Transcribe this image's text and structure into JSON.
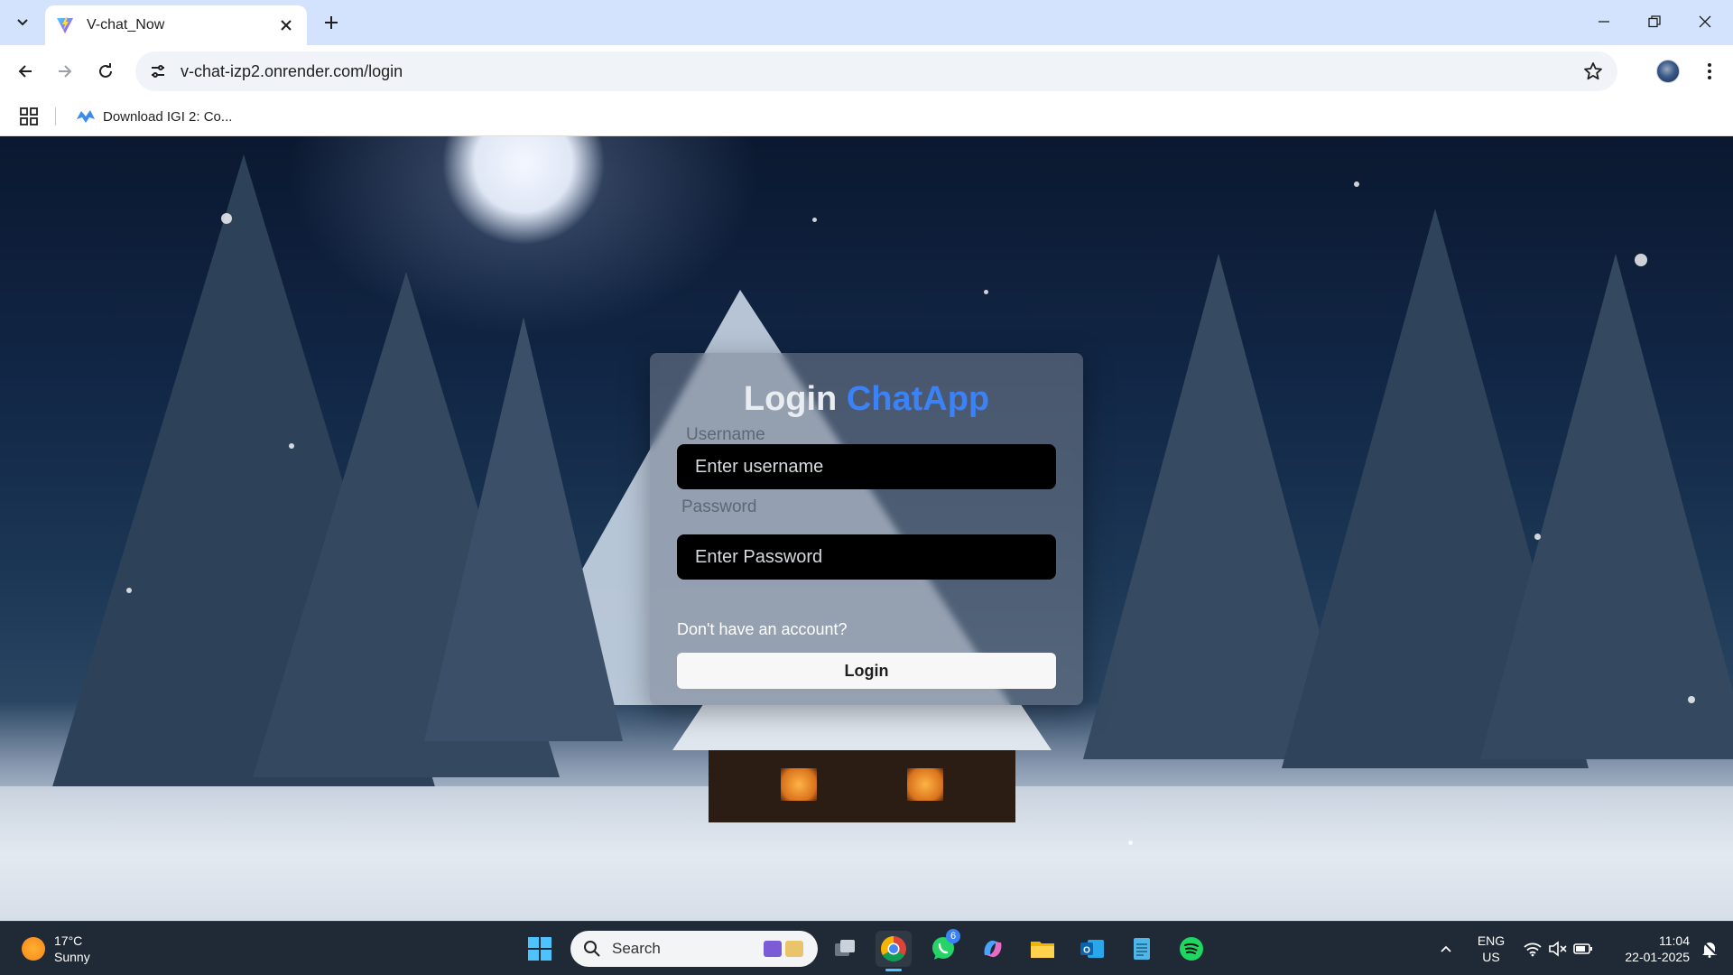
{
  "browser": {
    "tab_title": "V-chat_Now",
    "url": "v-chat-izp2.onrender.com/login",
    "bookmark_label": "Download IGI 2: Co..."
  },
  "login": {
    "title_prefix": "Login",
    "title_brand": "ChatApp",
    "username_label": "Username",
    "username_placeholder": "Enter username",
    "password_label": "Password",
    "password_placeholder": "Enter Password",
    "signup_link": "Don't have an account?",
    "submit_label": "Login"
  },
  "colors": {
    "brand_accent": "#3b82f6",
    "tabstrip": "#d3e3fd",
    "taskbar": "#1f2a36"
  },
  "taskbar": {
    "weather_temp": "17°C",
    "weather_desc": "Sunny",
    "search_label": "Search",
    "whatsapp_badge": "6",
    "lang_top": "ENG",
    "lang_bottom": "US",
    "time": "11:04",
    "date": "22-01-2025",
    "icons": [
      "windows-start-icon",
      "task-view-icon",
      "chrome-icon",
      "whatsapp-icon",
      "copilot-icon",
      "file-explorer-icon",
      "outlook-icon",
      "notepad-icon",
      "spotify-icon"
    ]
  }
}
